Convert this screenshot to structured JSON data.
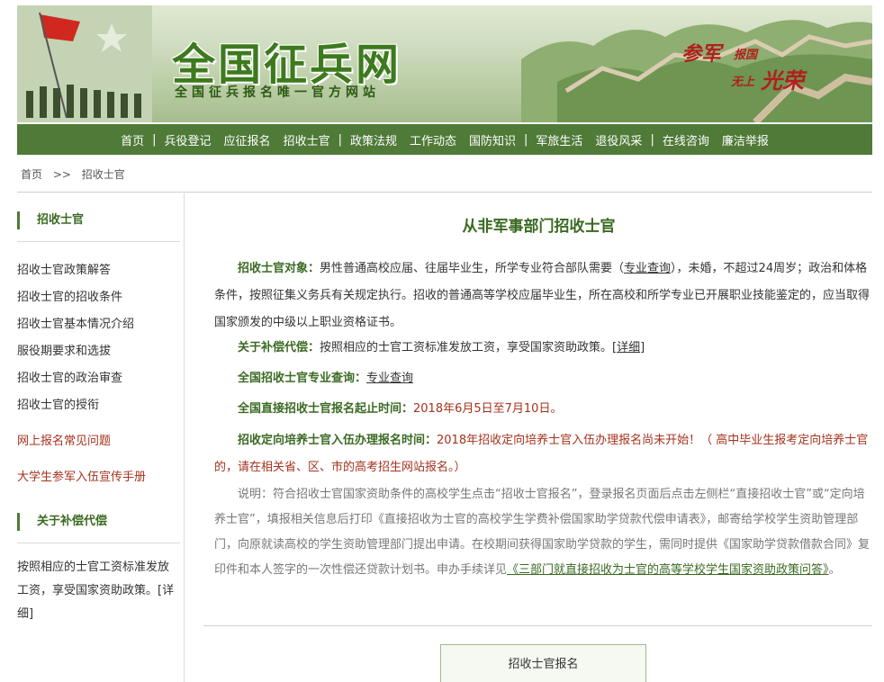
{
  "header": {
    "site_title": "全国征兵网",
    "site_subtitle": "全国征兵报名唯一官方网站",
    "slogan": {
      "part1": "参军",
      "part2": "报国",
      "part3": "无上",
      "part4": "光荣"
    }
  },
  "nav": {
    "items": [
      "首页",
      "兵役登记",
      "应征报名",
      "招收士官",
      "政策法规",
      "工作动态",
      "国防知识",
      "军旅生活",
      "退役风采",
      "在线咨询",
      "廉洁举报"
    ],
    "separator": "|"
  },
  "breadcrumb": {
    "home": "首页",
    "sep": ">>",
    "current": "招收士官"
  },
  "sidebar": {
    "section1_title": "招收士官",
    "links": [
      "招收士官政策解答",
      "招收士官的招收条件",
      "招收士官基本情况介绍",
      "服役期要求和选拔",
      "招收士官的政治审查",
      "招收士官的授衔"
    ],
    "red_links": [
      "网上报名常见问题",
      "大学生参军入伍宣传手册"
    ],
    "section2_title": "关于补偿代偿",
    "section2_text": "按照相应的士官工资标准发放工资，享受国家资助政策。",
    "section2_link": "[详细]"
  },
  "main": {
    "title": "从非军事部门招收士官",
    "p1_label": "招收士官对象：",
    "p1_text_a": "男性普通高校应届、往届毕业生，所学专业符合部队需要（",
    "p1_link": "专业查询",
    "p1_text_b": "），未婚，不超过24周岁；政治和体格条件，按照征集义务兵有关规定执行。招收的普通高等学校应届毕业生，所在高校和所学专业已开展职业技能鉴定的，应当取得国家颁发的中级以上职业资格证书。",
    "p2_label": "关于补偿代偿：",
    "p2_text": "按照相应的士官工资标准发放工资，享受国家资助政策。",
    "p2_link": "[详细]",
    "p3_label": "全国招收士官专业查询：",
    "p3_link": "专业查询",
    "p4_label": "全国直接招收士官报名起止时间：",
    "p4_text": "2018年6月5日至7月10日。",
    "p5_label": "招收定向培养士官入伍办理报名时间：",
    "p5_text": "2018年招收定向培养士官入伍办理报名尚未开始！（ 高中毕业生报考定向培养士官的，请在相关省、区、市的高考招生网站报名。）",
    "note_text": "说明：符合招收士官国家资助条件的高校学生点击“招收士官报名”，登录报名页面后点击左侧栏“直接招收士官”或“定向培养士官”，填报相关信息后打印《直接招收为士官的高校学生学费补偿国家助学贷款代偿申请表》，邮寄给学校学生资助管理部门，向原就读高校的学生资助管理部门提出申请。在校期间获得国家助学贷款的学生，需同时提供《国家助学贷款借款合同》复印件和本人签字的一次性偿还贷款计划书。申办手续详见",
    "note_link": "《三部门就直接招收为士官的高等学校学生国家资助政策问答》",
    "note_end": "。",
    "apply_button": "招收士官报名"
  },
  "colors": {
    "primary_green": "#4f7a38",
    "title_green": "#3b6a22",
    "accent_red": "#a5321c"
  }
}
